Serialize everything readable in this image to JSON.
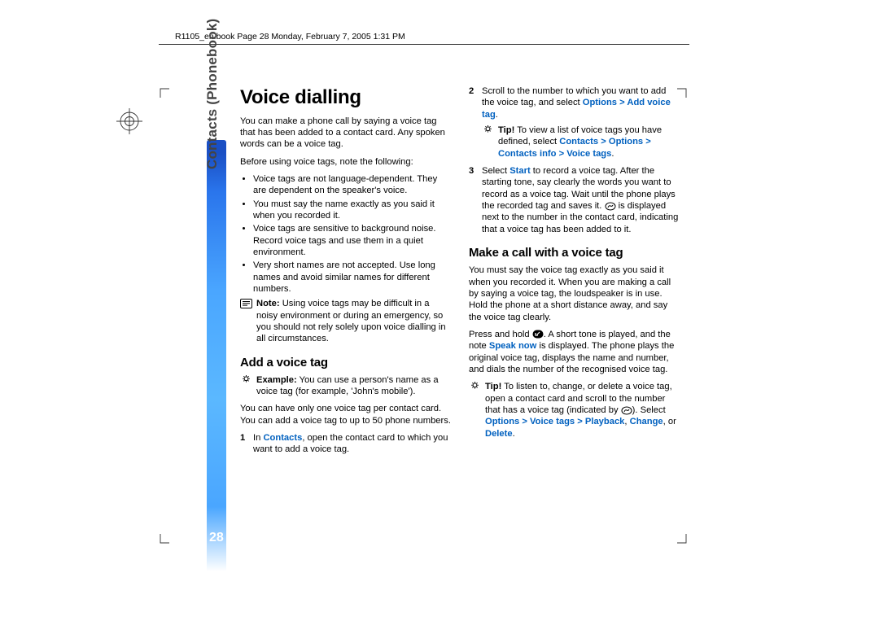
{
  "header": "R1105_en.book  Page 28  Monday, February 7, 2005  1:31 PM",
  "sideLabel": "Contacts (Phonebook)",
  "pageNumber": "28",
  "col1": {
    "title": "Voice dialling",
    "intro": "You can make a phone call by saying a voice tag that has been added to a contact card. Any spoken words can be a voice tag.",
    "beforeLine": "Before using voice tags, note the following:",
    "bullets": [
      "Voice tags are not language-dependent. They are dependent on the speaker's voice.",
      "You must say the name exactly as you said it when you recorded it.",
      "Voice tags are sensitive to background noise. Record voice tags and use them in a quiet environment.",
      "Very short names are not accepted. Use long names and avoid similar names for different numbers."
    ],
    "noteLabel": "Note:",
    "noteBody": " Using voice tags may be difficult in a noisy environment or during an emergency, so you should not rely solely upon voice dialling in all circumstances.",
    "h2a": "Add a voice tag",
    "exampleLabel": "Example:",
    "exampleBody": " You can use a person's name as a voice tag (for example, 'John's mobile').",
    "limit": "You can have only one voice tag per contact card. You can add a voice tag to up to 50 phone numbers.",
    "step1Num": "1",
    "step1Pre": "In ",
    "step1Link": "Contacts",
    "step1Post": ", open the contact card to which you want to add a voice tag."
  },
  "col2": {
    "step2Num": "2",
    "step2Pre": "Scroll to the number to which you want to add the voice tag, and select ",
    "step2Link": "Options > Add voice tag",
    "step2Post": ".",
    "tip1Label": "Tip!",
    "tip1Pre": " To view a list of voice tags you have defined, select ",
    "tip1Link": "Contacts > Options > Contacts info > Voice tags",
    "tip1Post": ".",
    "step3Num": "3",
    "step3Pre": "Select ",
    "step3Link": "Start",
    "step3Mid": " to record a voice tag. After the starting tone, say clearly the words you want to record as a voice tag. Wait until the phone plays the recorded tag and saves it. ",
    "step3Post": " is displayed next to the number in the contact card, indicating that a voice tag has been added to it.",
    "h2b": "Make a call with a voice tag",
    "make1": "You must say the voice tag exactly as you said it when you recorded it. When you are making a call by saying a voice tag, the loudspeaker is in use. Hold the phone at a short distance away, and say the voice tag clearly.",
    "make2Pre": "Press and hold ",
    "make2Mid": ". A short tone is played, and the note ",
    "make2Speak": "Speak now",
    "make2Post": " is displayed. The phone plays the original voice tag, displays the name and number, and dials the number of the recognised voice tag.",
    "tip2Label": "Tip!",
    "tip2Pre": " To listen to, change, or delete a voice tag, open a contact card and scroll to the number that has a voice tag (indicated by ",
    "tip2Mid": "). Select ",
    "tip2Link1": "Options > Voice tags > Playback",
    "tip2Comma1": ", ",
    "tip2Link2": "Change",
    "tip2Or": ", or ",
    "tip2Link3": "Delete",
    "tip2Post": "."
  }
}
